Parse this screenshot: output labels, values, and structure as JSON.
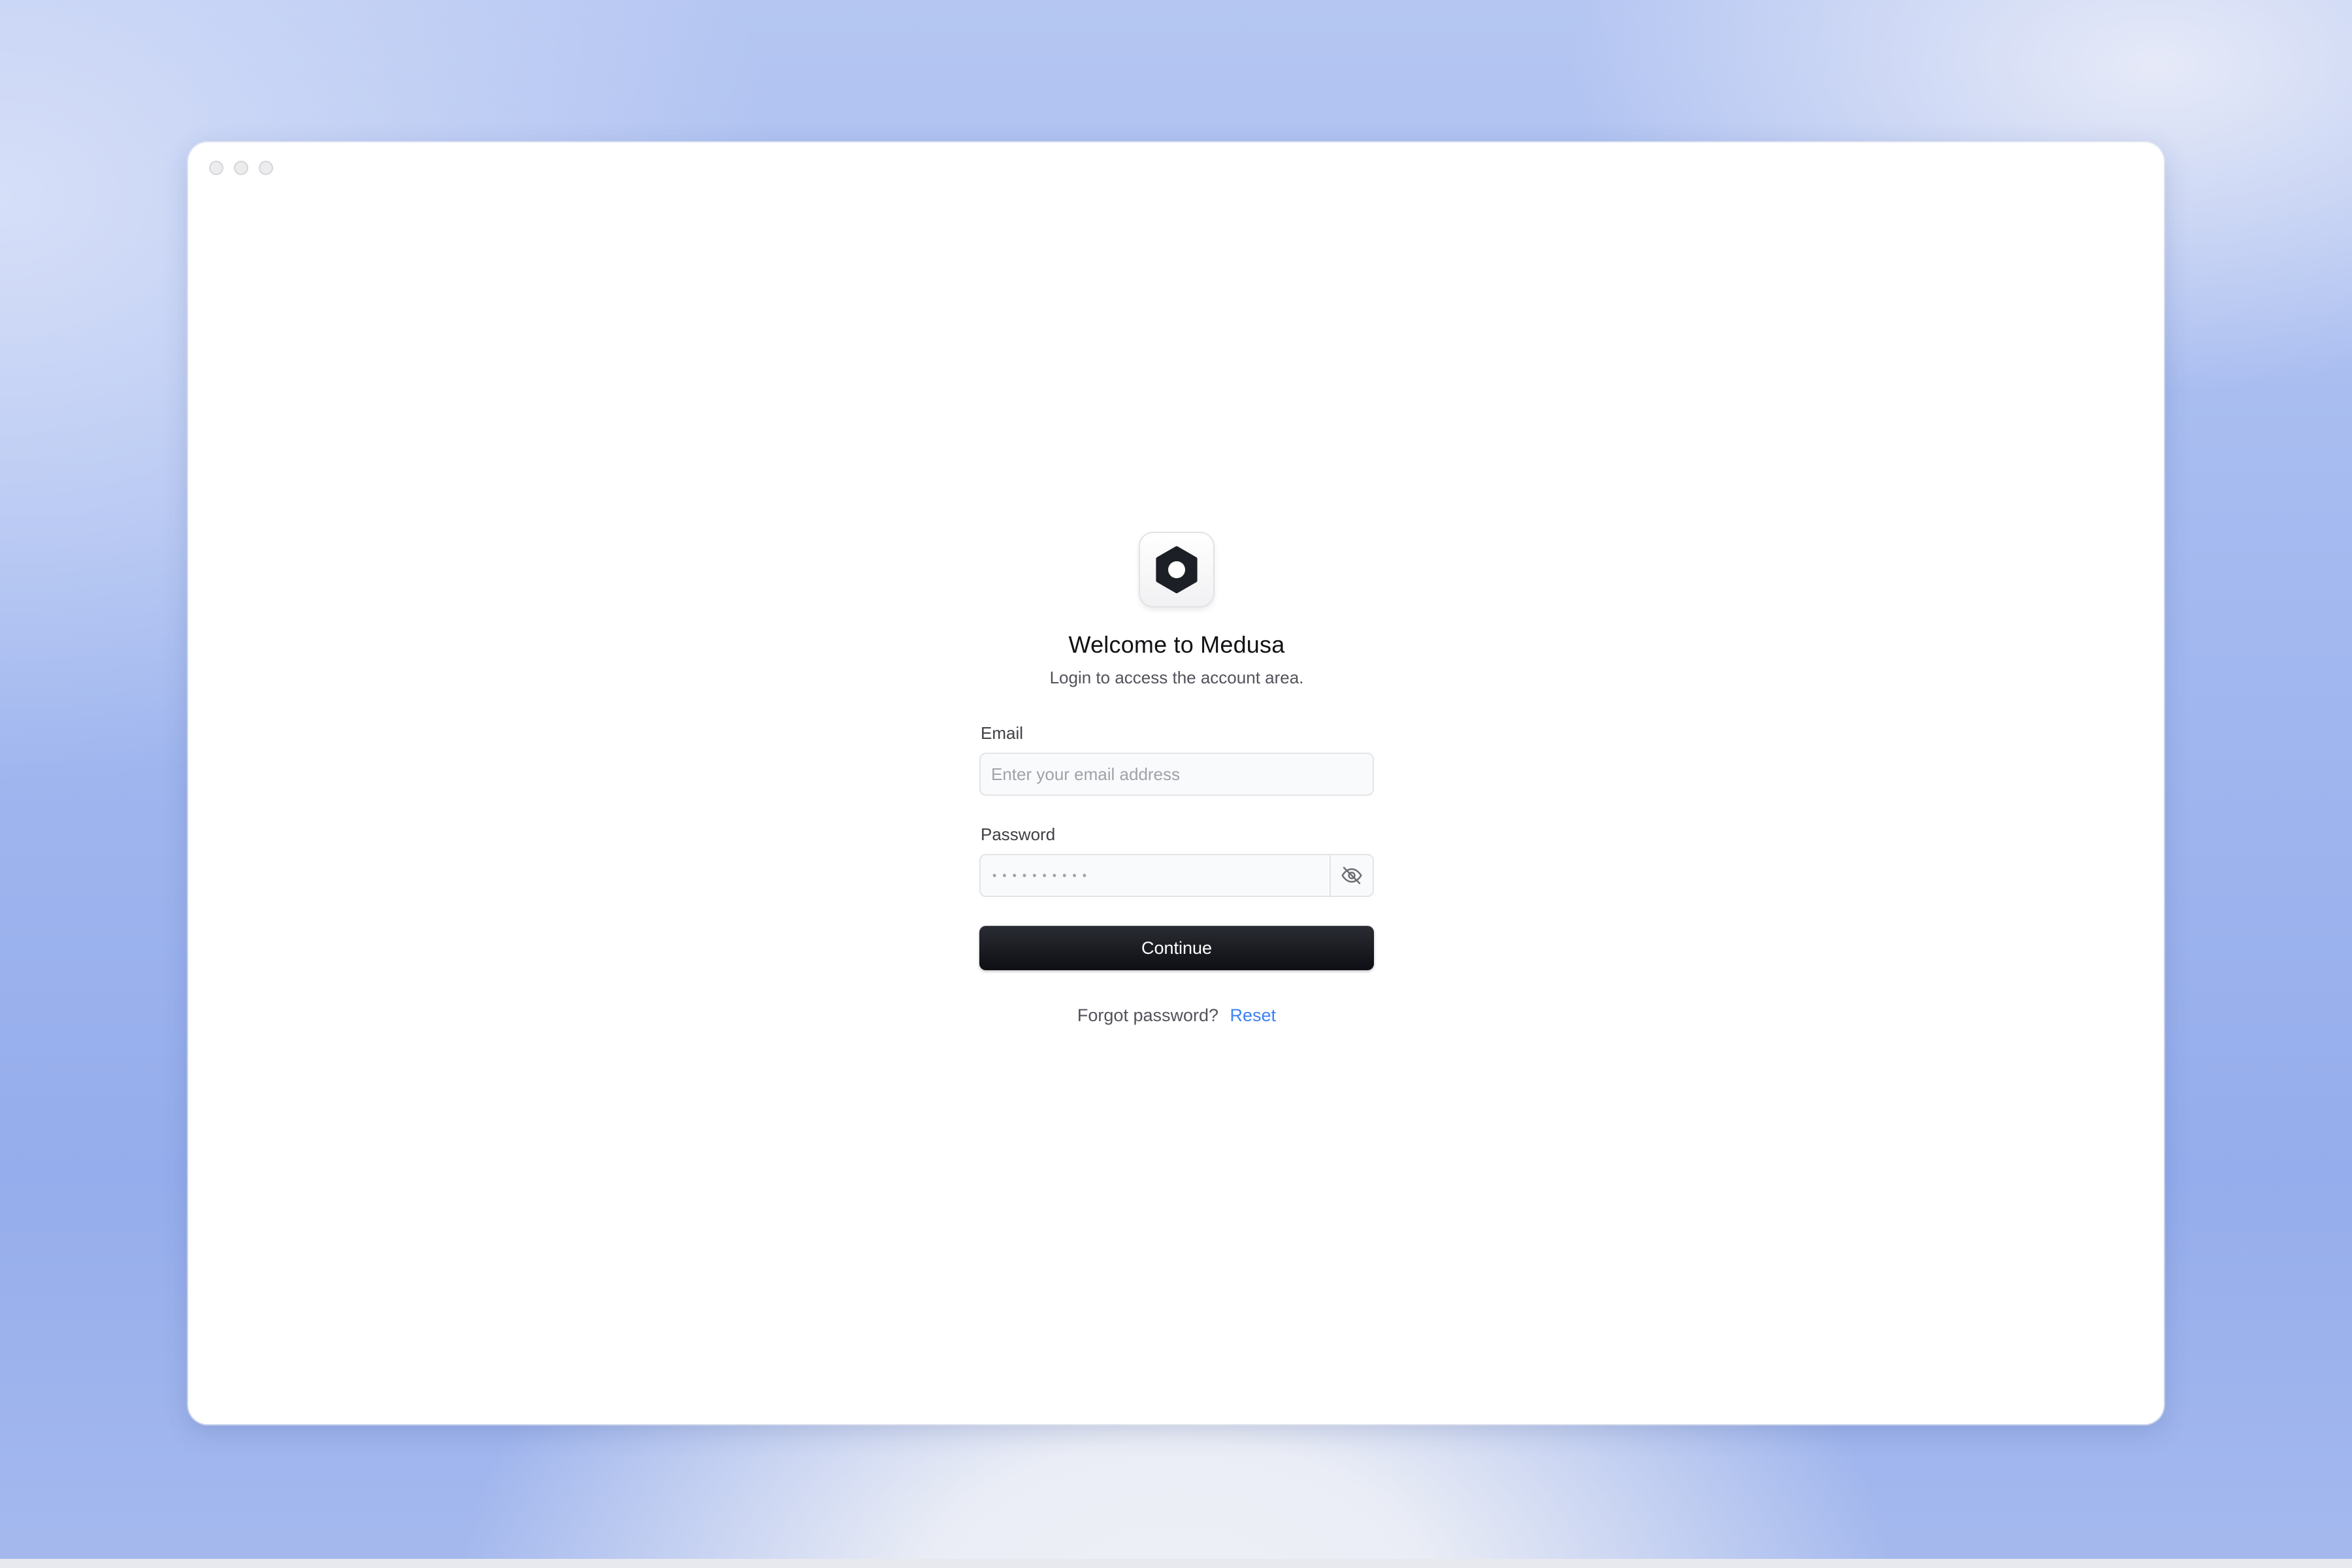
{
  "window": {
    "controls": [
      "close",
      "minimize",
      "maximize"
    ]
  },
  "logo": {
    "icon": "medusa-logo-icon"
  },
  "header": {
    "title": "Welcome to Medusa",
    "subtitle": "Login to access the account area."
  },
  "form": {
    "email_label": "Email",
    "email_placeholder": "Enter your email address",
    "email_value": "",
    "password_label": "Password",
    "password_mask": "••••••••••",
    "password_toggle_icon": "eye-off-icon",
    "continue_label": "Continue"
  },
  "footer": {
    "forgot_text": "Forgot password?",
    "reset_label": "Reset"
  },
  "colors": {
    "accent_link": "#3b82f6",
    "button_bg": "#111318"
  }
}
